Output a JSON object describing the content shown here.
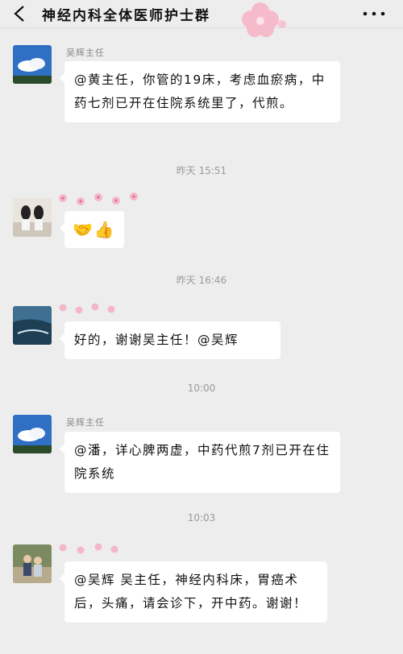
{
  "header": {
    "title": "神经内科全体医师护士群"
  },
  "messages": [
    {
      "sender": "吴辉主任",
      "text": "@黄主任，你管的19床，考虑血瘀病，中药七剂已开在住院系统里了，代煎。"
    },
    {
      "time": "昨天 15:51",
      "text": "🤝👍"
    },
    {
      "time": "昨天 16:46",
      "text": "好的，谢谢吴主任！@吴辉"
    },
    {
      "time": "10:00",
      "sender": "吴辉主任",
      "text": "@潘，详心脾两虚，中药代煎7剂已开在住院系统"
    },
    {
      "time": "10:03",
      "text": "@吴辉  吴主任，神经内科床，胃癌术后，头痛，请会诊下，开中药。谢谢！"
    }
  ]
}
